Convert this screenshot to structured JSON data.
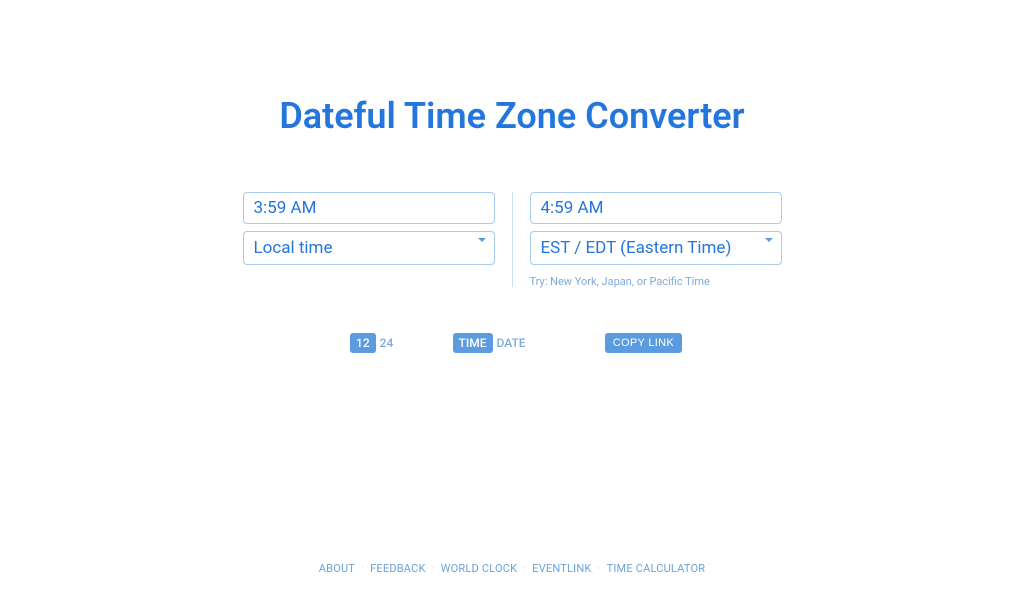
{
  "title": "Dateful Time Zone Converter",
  "left": {
    "time": "3:59 AM",
    "zone": "Local time"
  },
  "right": {
    "time": "4:59 AM",
    "zone": "EST / EDT (Eastern Time)",
    "hint_prefix": "Try: ",
    "hint_links": [
      "New York",
      "Japan",
      "Pacific Time"
    ]
  },
  "controls": {
    "hour12": "12",
    "hour24": "24",
    "time_label": "TIME",
    "date_label": "DATE",
    "copy_link": "COPY LINK"
  },
  "footer": {
    "links": [
      "ABOUT",
      "FEEDBACK",
      "WORLD CLOCK",
      "EVENTLINK",
      "TIME CALCULATOR"
    ]
  }
}
